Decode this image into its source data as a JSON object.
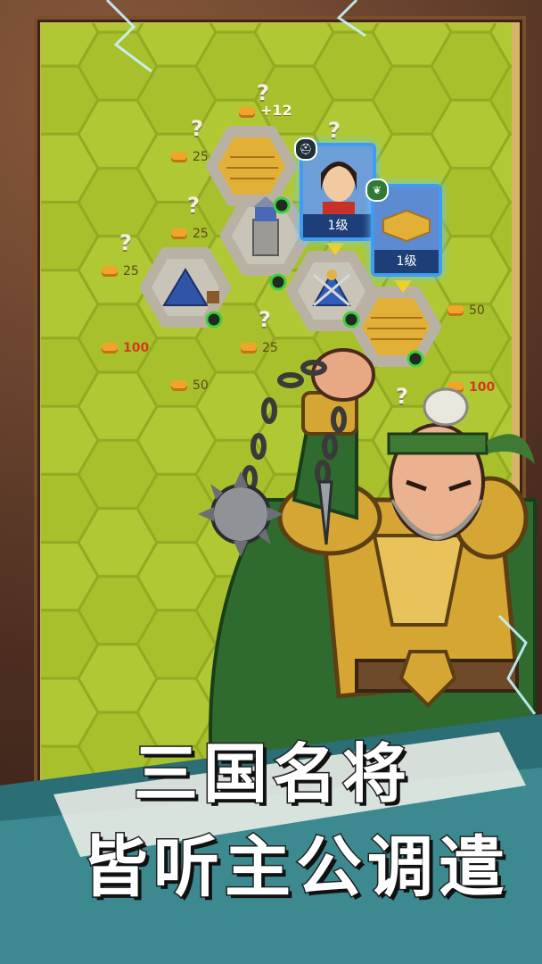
{
  "headline": {
    "line1": "三国名将",
    "line2": "皆听主公调遣"
  },
  "cards": [
    {
      "name": "general-card",
      "level": "1级",
      "border_color": "#3f9cf0"
    },
    {
      "name": "farm-card",
      "level": "1级",
      "border_color": "#3f9cf0"
    }
  ],
  "reward_popup": "+12",
  "tile_labels": [
    {
      "value": "25",
      "icon": "coin-icon"
    },
    {
      "value": "25",
      "icon": "coin-icon"
    },
    {
      "value": "25",
      "icon": "coin-icon"
    },
    {
      "value": "100",
      "icon": "coin-icon",
      "highlight": true
    },
    {
      "value": "50",
      "icon": "coin-icon"
    },
    {
      "value": "25",
      "icon": "coin-icon"
    },
    {
      "value": "50",
      "icon": "coin-icon"
    },
    {
      "value": "100",
      "icon": "coin-icon",
      "highlight": true
    }
  ],
  "mystery_marks": [
    "?",
    "?",
    "?",
    "?",
    "?",
    "?",
    "?"
  ],
  "colors": {
    "grass": "#a8c02c",
    "grass_hex_line": "#93aa22",
    "stone_wall": "#b9b2a4",
    "highlight_red": "#d43a1e",
    "card_border": "#3f9cf0",
    "armor_gold": "#d6a634",
    "cloak_green": "#2f6b2e"
  }
}
